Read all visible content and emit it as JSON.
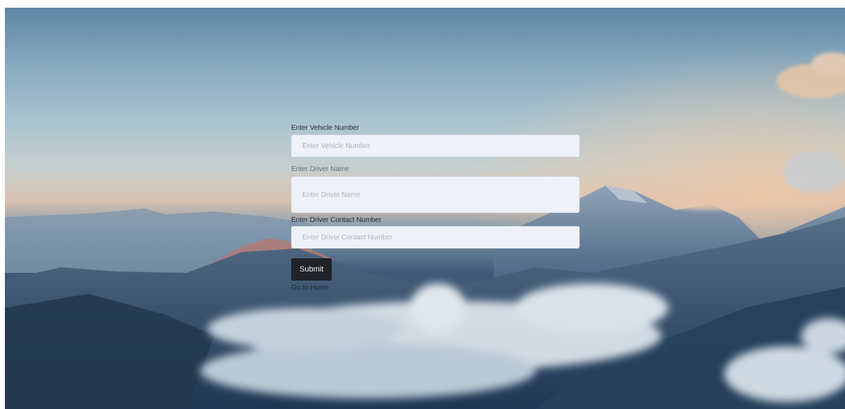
{
  "form": {
    "vehicle_label": "Enter Vehicle Number",
    "vehicle_placeholder": "Enter Vehicle Number",
    "driver_name_label": "Enter Driver Name",
    "driver_name_placeholder": "Enter Driver Name",
    "driver_contact_label": "Enter Driver Contact Number",
    "driver_contact_placeholder": "Enter Driver Contact Number",
    "submit_label": "Submit",
    "home_link": "Go to Home"
  },
  "background": {
    "sky_top": "#5f87a4",
    "horizon": "#d8c2b0",
    "mountain": "#2b4566",
    "cloud": "#dfe8ef"
  }
}
